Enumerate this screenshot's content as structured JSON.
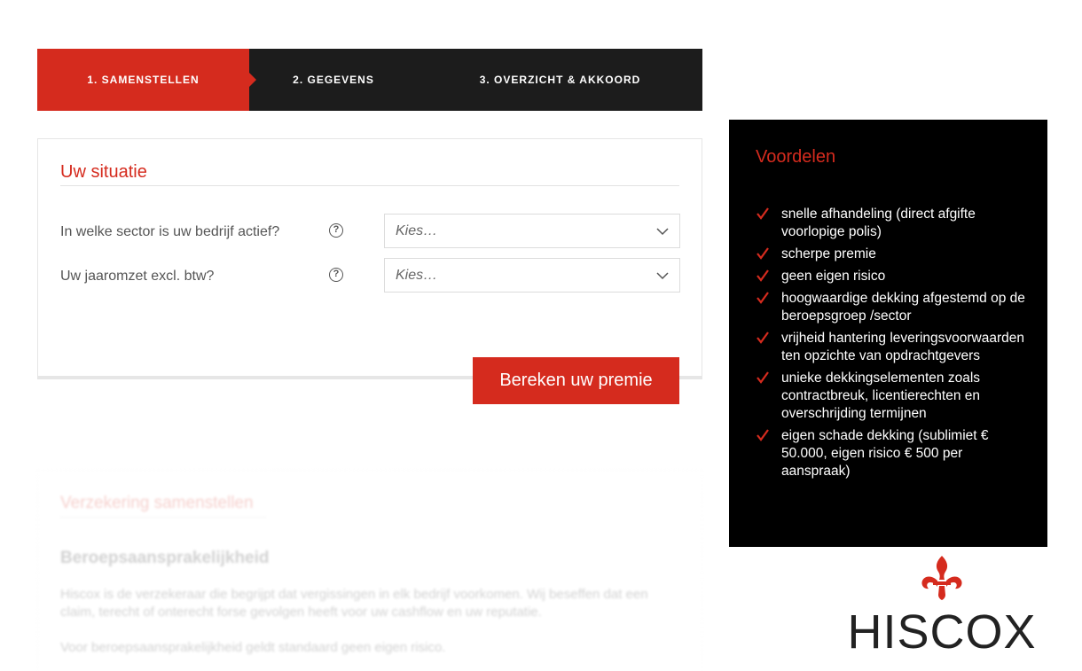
{
  "steps": [
    {
      "label": "1. SAMENSTELLEN",
      "active": true
    },
    {
      "label": "2. GEGEVENS",
      "active": false
    },
    {
      "label": "3. OVERZICHT & AKKOORD",
      "active": false
    }
  ],
  "form": {
    "title": "Uw situatie",
    "fields": [
      {
        "label": "In welke sector is uw bedrijf actief?",
        "value": "Kies…",
        "help": "?"
      },
      {
        "label": "Uw jaaromzet excl. btw?",
        "value": "Kies…",
        "help": "?"
      }
    ],
    "submit_label": "Bereken uw premie"
  },
  "faded_section": {
    "title": "Verzekering samenstellen",
    "heading": "Beroepsaansprakelijkheid",
    "paragraph1": "Hiscox is de verzekeraar die begrijpt dat vergissingen in elk bedrijf voorkomen. Wij beseffen dat een claim, terecht of onterecht forse gevolgen heeft voor uw cashflow en uw reputatie.",
    "paragraph2": "Voor beroepsaansprakelijkheid geldt standaard geen eigen risico."
  },
  "benefits": {
    "title": "Voordelen",
    "items": [
      "snelle afhandeling (direct afgifte voorlopige polis)",
      "scherpe premie",
      "geen eigen risico",
      "hoogwaardige dekking afgestemd op de beroepsgroep /sector",
      "vrijheid hantering leveringsvoorwaarden ten opzichte van opdrachtgevers",
      "unieke dekkingselementen zoals contractbreuk, licentierechten en overschrijding termijnen",
      "eigen schade dekking (sublimiet € 50.000, eigen risico € 500 per aanspraak)"
    ]
  },
  "logo": {
    "text": "HISCOX",
    "icon": "fleur-de-lis-icon"
  },
  "colors": {
    "brand_red": "#d52b1e",
    "steps_bg": "#1c1c1c",
    "panel_bg": "#000000"
  }
}
